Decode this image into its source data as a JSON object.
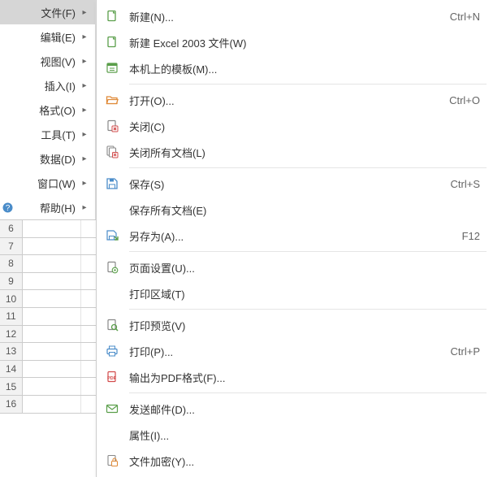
{
  "menubar": {
    "items": [
      {
        "label": "文件(F)",
        "active": true,
        "has_arrow": true,
        "has_help": false
      },
      {
        "label": "编辑(E)",
        "active": false,
        "has_arrow": true,
        "has_help": false
      },
      {
        "label": "视图(V)",
        "active": false,
        "has_arrow": true,
        "has_help": false
      },
      {
        "label": "插入(I)",
        "active": false,
        "has_arrow": true,
        "has_help": false
      },
      {
        "label": "格式(O)",
        "active": false,
        "has_arrow": true,
        "has_help": false
      },
      {
        "label": "工具(T)",
        "active": false,
        "has_arrow": true,
        "has_help": false
      },
      {
        "label": "数据(D)",
        "active": false,
        "has_arrow": true,
        "has_help": false
      },
      {
        "label": "窗口(W)",
        "active": false,
        "has_arrow": true,
        "has_help": false
      },
      {
        "label": "帮助(H)",
        "active": false,
        "has_arrow": true,
        "has_help": true
      }
    ]
  },
  "grid": {
    "row_numbers": [
      "6",
      "7",
      "8",
      "9",
      "10",
      "11",
      "12",
      "13",
      "14",
      "15",
      "16"
    ]
  },
  "submenu": {
    "items": [
      {
        "type": "item",
        "icon": "new-doc",
        "label": "新建(N)...",
        "shortcut": "Ctrl+N"
      },
      {
        "type": "item",
        "icon": "new-doc",
        "label": "新建 Excel 2003 文件(W)",
        "shortcut": ""
      },
      {
        "type": "item",
        "icon": "template",
        "label": "本机上的模板(M)...",
        "shortcut": ""
      },
      {
        "type": "sep"
      },
      {
        "type": "item",
        "icon": "open-folder",
        "label": "打开(O)...",
        "shortcut": "Ctrl+O"
      },
      {
        "type": "item",
        "icon": "close-doc",
        "label": "关闭(C)",
        "shortcut": ""
      },
      {
        "type": "item",
        "icon": "close-all",
        "label": "关闭所有文档(L)",
        "shortcut": ""
      },
      {
        "type": "sep"
      },
      {
        "type": "item",
        "icon": "save",
        "label": "保存(S)",
        "shortcut": "Ctrl+S"
      },
      {
        "type": "item",
        "icon": "",
        "label": "保存所有文档(E)",
        "shortcut": ""
      },
      {
        "type": "item",
        "icon": "save-as",
        "label": "另存为(A)...",
        "shortcut": "F12"
      },
      {
        "type": "sep"
      },
      {
        "type": "item",
        "icon": "page-setup",
        "label": "页面设置(U)...",
        "shortcut": ""
      },
      {
        "type": "item",
        "icon": "",
        "label": "打印区域(T)",
        "shortcut": ""
      },
      {
        "type": "sep"
      },
      {
        "type": "item",
        "icon": "print-preview",
        "label": "打印预览(V)",
        "shortcut": ""
      },
      {
        "type": "item",
        "icon": "print",
        "label": "打印(P)...",
        "shortcut": "Ctrl+P"
      },
      {
        "type": "item",
        "icon": "export-pdf",
        "label": "输出为PDF格式(F)...",
        "shortcut": ""
      },
      {
        "type": "sep"
      },
      {
        "type": "item",
        "icon": "send-mail",
        "label": "发送邮件(D)...",
        "shortcut": ""
      },
      {
        "type": "item",
        "icon": "",
        "label": "属性(I)...",
        "shortcut": ""
      },
      {
        "type": "item",
        "icon": "encrypt",
        "label": "文件加密(Y)...",
        "shortcut": ""
      }
    ]
  },
  "colors": {
    "icon_green": "#5a9e4a",
    "icon_orange": "#e08b3a",
    "icon_blue": "#4a8cc9",
    "icon_red": "#d24b4b",
    "icon_gray": "#888"
  }
}
